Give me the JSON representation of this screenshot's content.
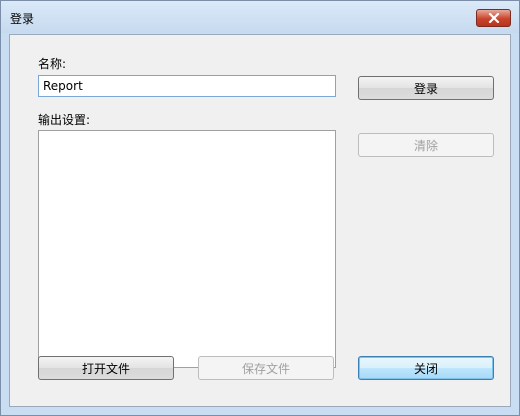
{
  "window": {
    "title": "登录"
  },
  "form": {
    "name_label": "名称:",
    "name_value": "Report",
    "output_label": "输出设置:"
  },
  "buttons": {
    "login": "登录",
    "clear": "清除",
    "open_file": "打开文件",
    "save_file": "保存文件",
    "close": "关闭"
  },
  "icons": {
    "close": "close-x-icon"
  },
  "colors": {
    "close_button": "#c9442c",
    "title_bar": "#c9ddf2",
    "client_bg": "#f0f0f0",
    "input_border": "#7aa7d4",
    "default_button_border": "#3c7fb1"
  }
}
